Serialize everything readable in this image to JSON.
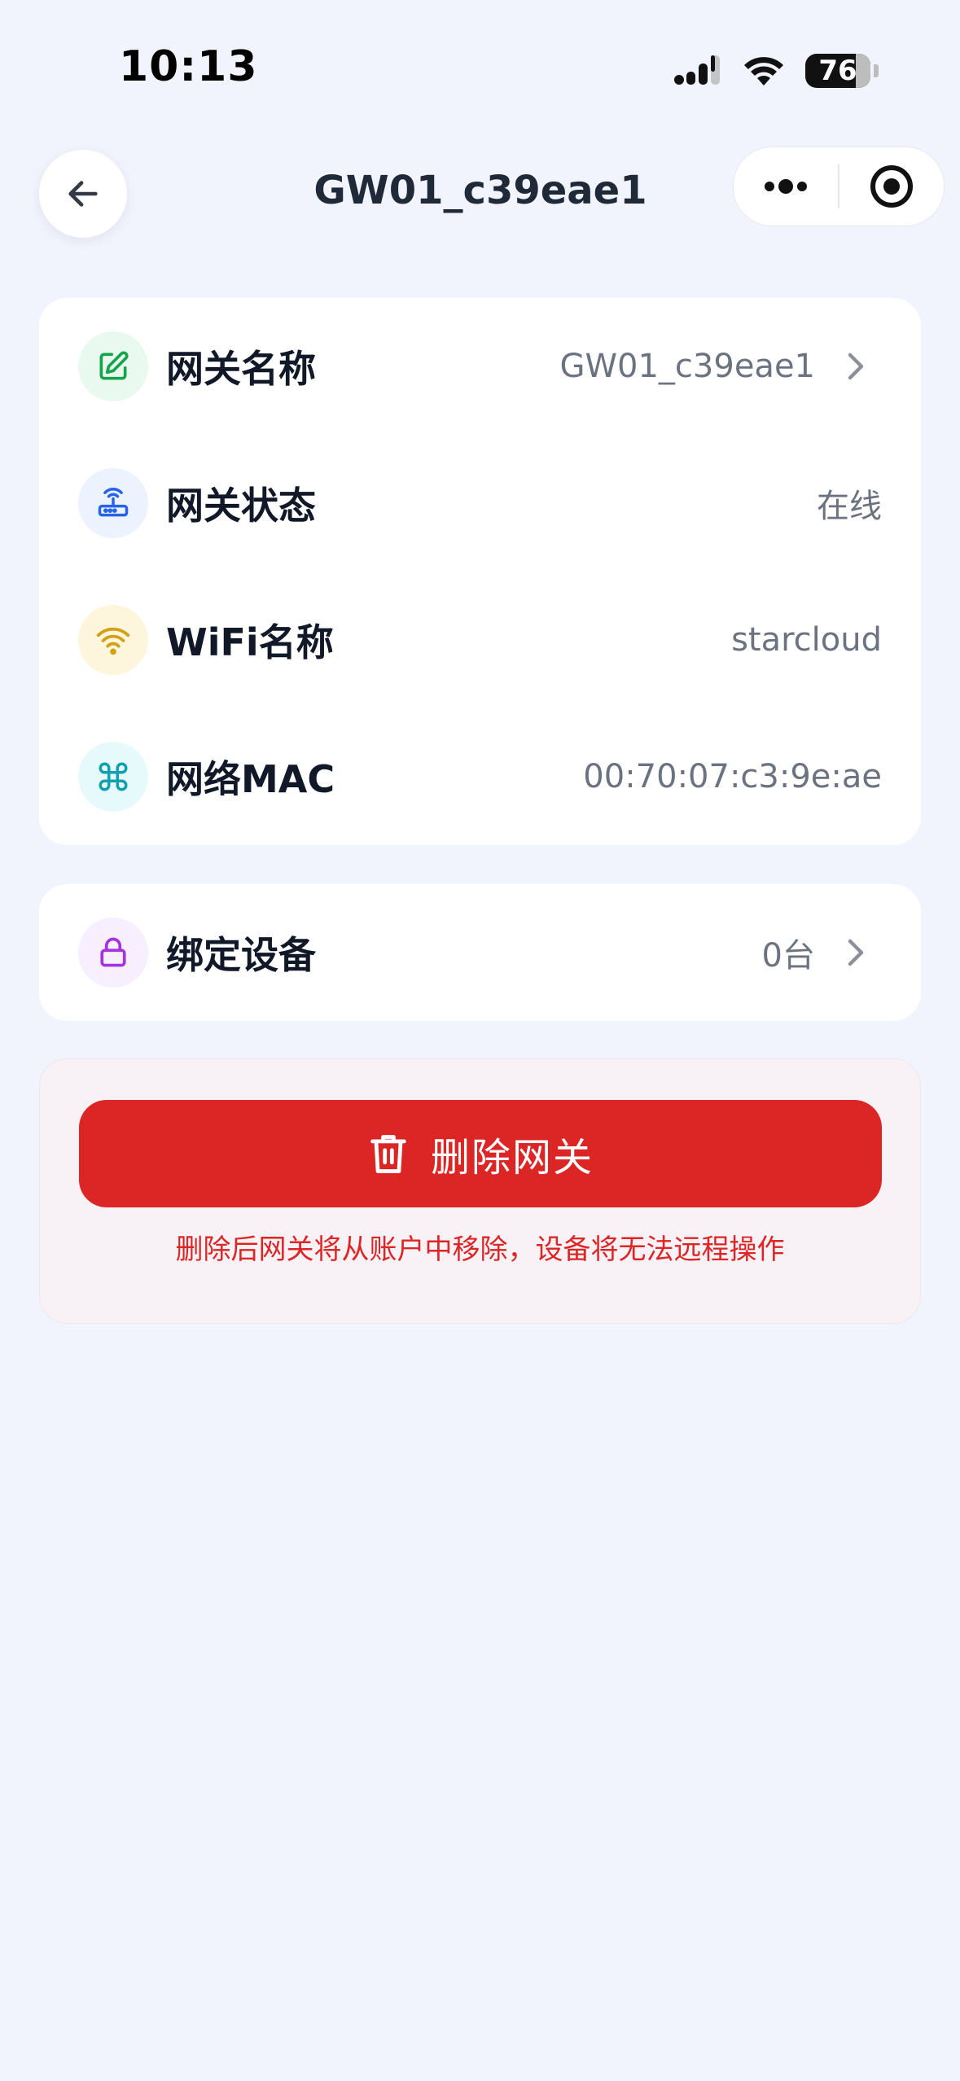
{
  "status_bar": {
    "time": "10:13",
    "battery": "76",
    "icons": [
      "signal-icon",
      "wifi-icon",
      "battery-icon"
    ]
  },
  "nav": {
    "title": "GW01_c39eae1",
    "back_icon": "arrow-left-icon",
    "capsule_icons": [
      "more-dots-icon",
      "target-icon"
    ]
  },
  "info_rows": [
    {
      "label": "网关名称",
      "value": "GW01_c39eae1",
      "icon": "edit-icon",
      "icon_color": "#16a34a",
      "icon_bg": "#e9f9ef",
      "chevron": true
    },
    {
      "label": "网关状态",
      "value": "在线",
      "icon": "router-icon",
      "icon_color": "#2563eb",
      "icon_bg": "#edf2ff"
    },
    {
      "label": "WiFi名称",
      "value": "starcloud",
      "icon": "wifi-signal-icon",
      "icon_color": "#d4a017",
      "icon_bg": "#fef6dc"
    },
    {
      "label": "网络MAC",
      "value": "00:70:07:c3:9e:ae",
      "icon": "command-icon",
      "icon_color": "#0e9fb0",
      "icon_bg": "#e7fafb"
    }
  ],
  "bind_row": {
    "label": "绑定设备",
    "value": "0台",
    "icon": "lock-icon",
    "icon_color": "#a333e0",
    "icon_bg": "#f7eefe",
    "chevron": true
  },
  "danger": {
    "button_label": "删除网关",
    "button_icon": "trash-icon",
    "note": "删除后网关将从账户中移除，设备将无法远程操作",
    "color": "#dc2626"
  }
}
